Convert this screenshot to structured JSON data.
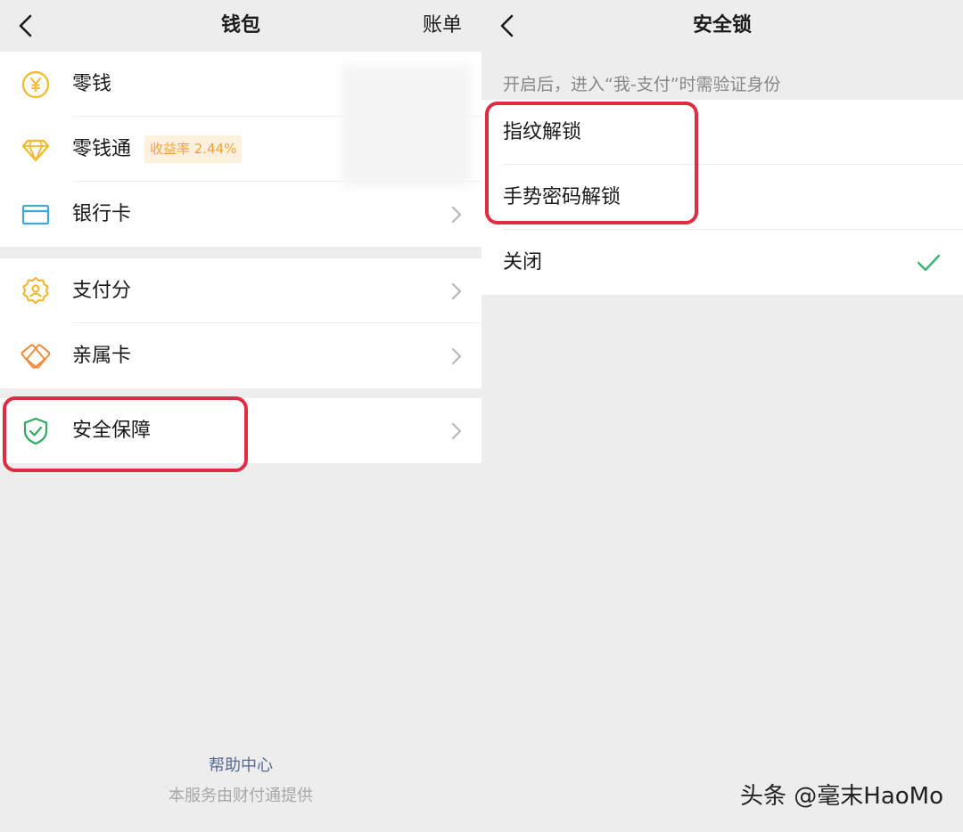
{
  "wallet": {
    "title": "钱包",
    "back_icon": "chevron-left-icon",
    "bills_label": "账单",
    "group1": [
      {
        "label": "零钱",
        "icon": "yuan-coin-icon"
      },
      {
        "label": "零钱通",
        "icon": "diamond-icon",
        "badge": "收益率 2.44%"
      },
      {
        "label": "银行卡",
        "icon": "bank-card-icon"
      }
    ],
    "group2": [
      {
        "label": "支付分",
        "icon": "credit-score-icon"
      },
      {
        "label": "亲属卡",
        "icon": "family-card-icon"
      }
    ],
    "group3": [
      {
        "label": "安全保障",
        "icon": "shield-check-icon"
      }
    ],
    "help_center": "帮助中心",
    "provider_note": "本服务由财付通提供"
  },
  "security_lock": {
    "title": "安全锁",
    "back_icon": "chevron-left-icon",
    "hint": "开启后，进入“我-支付”时需验证身份",
    "options": [
      {
        "label": "指纹解锁",
        "checked": false
      },
      {
        "label": "手势密码解锁",
        "checked": false
      },
      {
        "label": "关闭",
        "checked": true
      }
    ]
  },
  "watermark": "头条 @毫末HaoMo",
  "colors": {
    "highlight": "#e02b42",
    "check": "#3cb371",
    "coin": "#f2b92b",
    "card": "#3fa9d9",
    "score": "#f0b429",
    "family": "#f08c3c",
    "shield": "#2faa5f",
    "badge_text": "#f1a23a",
    "badge_bg": "#fdf1dd"
  }
}
